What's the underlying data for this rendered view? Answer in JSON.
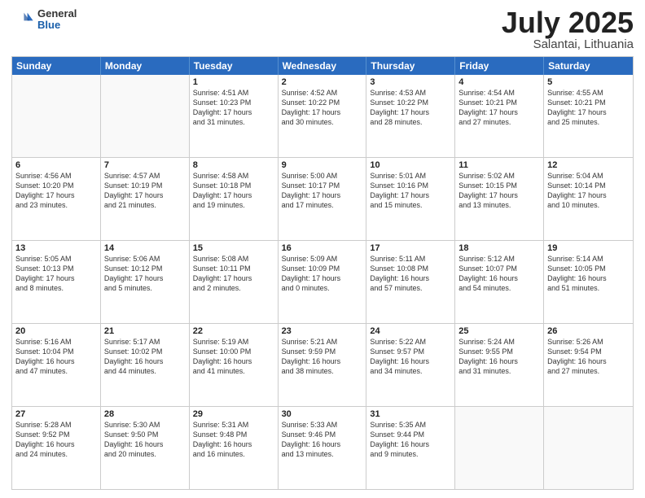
{
  "header": {
    "logo_general": "General",
    "logo_blue": "Blue",
    "title_month": "July 2025",
    "title_location": "Salantai, Lithuania"
  },
  "weekdays": [
    "Sunday",
    "Monday",
    "Tuesday",
    "Wednesday",
    "Thursday",
    "Friday",
    "Saturday"
  ],
  "weeks": [
    [
      {
        "day": "",
        "info": ""
      },
      {
        "day": "",
        "info": ""
      },
      {
        "day": "1",
        "info": "Sunrise: 4:51 AM\nSunset: 10:23 PM\nDaylight: 17 hours\nand 31 minutes."
      },
      {
        "day": "2",
        "info": "Sunrise: 4:52 AM\nSunset: 10:22 PM\nDaylight: 17 hours\nand 30 minutes."
      },
      {
        "day": "3",
        "info": "Sunrise: 4:53 AM\nSunset: 10:22 PM\nDaylight: 17 hours\nand 28 minutes."
      },
      {
        "day": "4",
        "info": "Sunrise: 4:54 AM\nSunset: 10:21 PM\nDaylight: 17 hours\nand 27 minutes."
      },
      {
        "day": "5",
        "info": "Sunrise: 4:55 AM\nSunset: 10:21 PM\nDaylight: 17 hours\nand 25 minutes."
      }
    ],
    [
      {
        "day": "6",
        "info": "Sunrise: 4:56 AM\nSunset: 10:20 PM\nDaylight: 17 hours\nand 23 minutes."
      },
      {
        "day": "7",
        "info": "Sunrise: 4:57 AM\nSunset: 10:19 PM\nDaylight: 17 hours\nand 21 minutes."
      },
      {
        "day": "8",
        "info": "Sunrise: 4:58 AM\nSunset: 10:18 PM\nDaylight: 17 hours\nand 19 minutes."
      },
      {
        "day": "9",
        "info": "Sunrise: 5:00 AM\nSunset: 10:17 PM\nDaylight: 17 hours\nand 17 minutes."
      },
      {
        "day": "10",
        "info": "Sunrise: 5:01 AM\nSunset: 10:16 PM\nDaylight: 17 hours\nand 15 minutes."
      },
      {
        "day": "11",
        "info": "Sunrise: 5:02 AM\nSunset: 10:15 PM\nDaylight: 17 hours\nand 13 minutes."
      },
      {
        "day": "12",
        "info": "Sunrise: 5:04 AM\nSunset: 10:14 PM\nDaylight: 17 hours\nand 10 minutes."
      }
    ],
    [
      {
        "day": "13",
        "info": "Sunrise: 5:05 AM\nSunset: 10:13 PM\nDaylight: 17 hours\nand 8 minutes."
      },
      {
        "day": "14",
        "info": "Sunrise: 5:06 AM\nSunset: 10:12 PM\nDaylight: 17 hours\nand 5 minutes."
      },
      {
        "day": "15",
        "info": "Sunrise: 5:08 AM\nSunset: 10:11 PM\nDaylight: 17 hours\nand 2 minutes."
      },
      {
        "day": "16",
        "info": "Sunrise: 5:09 AM\nSunset: 10:09 PM\nDaylight: 17 hours\nand 0 minutes."
      },
      {
        "day": "17",
        "info": "Sunrise: 5:11 AM\nSunset: 10:08 PM\nDaylight: 16 hours\nand 57 minutes."
      },
      {
        "day": "18",
        "info": "Sunrise: 5:12 AM\nSunset: 10:07 PM\nDaylight: 16 hours\nand 54 minutes."
      },
      {
        "day": "19",
        "info": "Sunrise: 5:14 AM\nSunset: 10:05 PM\nDaylight: 16 hours\nand 51 minutes."
      }
    ],
    [
      {
        "day": "20",
        "info": "Sunrise: 5:16 AM\nSunset: 10:04 PM\nDaylight: 16 hours\nand 47 minutes."
      },
      {
        "day": "21",
        "info": "Sunrise: 5:17 AM\nSunset: 10:02 PM\nDaylight: 16 hours\nand 44 minutes."
      },
      {
        "day": "22",
        "info": "Sunrise: 5:19 AM\nSunset: 10:00 PM\nDaylight: 16 hours\nand 41 minutes."
      },
      {
        "day": "23",
        "info": "Sunrise: 5:21 AM\nSunset: 9:59 PM\nDaylight: 16 hours\nand 38 minutes."
      },
      {
        "day": "24",
        "info": "Sunrise: 5:22 AM\nSunset: 9:57 PM\nDaylight: 16 hours\nand 34 minutes."
      },
      {
        "day": "25",
        "info": "Sunrise: 5:24 AM\nSunset: 9:55 PM\nDaylight: 16 hours\nand 31 minutes."
      },
      {
        "day": "26",
        "info": "Sunrise: 5:26 AM\nSunset: 9:54 PM\nDaylight: 16 hours\nand 27 minutes."
      }
    ],
    [
      {
        "day": "27",
        "info": "Sunrise: 5:28 AM\nSunset: 9:52 PM\nDaylight: 16 hours\nand 24 minutes."
      },
      {
        "day": "28",
        "info": "Sunrise: 5:30 AM\nSunset: 9:50 PM\nDaylight: 16 hours\nand 20 minutes."
      },
      {
        "day": "29",
        "info": "Sunrise: 5:31 AM\nSunset: 9:48 PM\nDaylight: 16 hours\nand 16 minutes."
      },
      {
        "day": "30",
        "info": "Sunrise: 5:33 AM\nSunset: 9:46 PM\nDaylight: 16 hours\nand 13 minutes."
      },
      {
        "day": "31",
        "info": "Sunrise: 5:35 AM\nSunset: 9:44 PM\nDaylight: 16 hours\nand 9 minutes."
      },
      {
        "day": "",
        "info": ""
      },
      {
        "day": "",
        "info": ""
      }
    ]
  ]
}
